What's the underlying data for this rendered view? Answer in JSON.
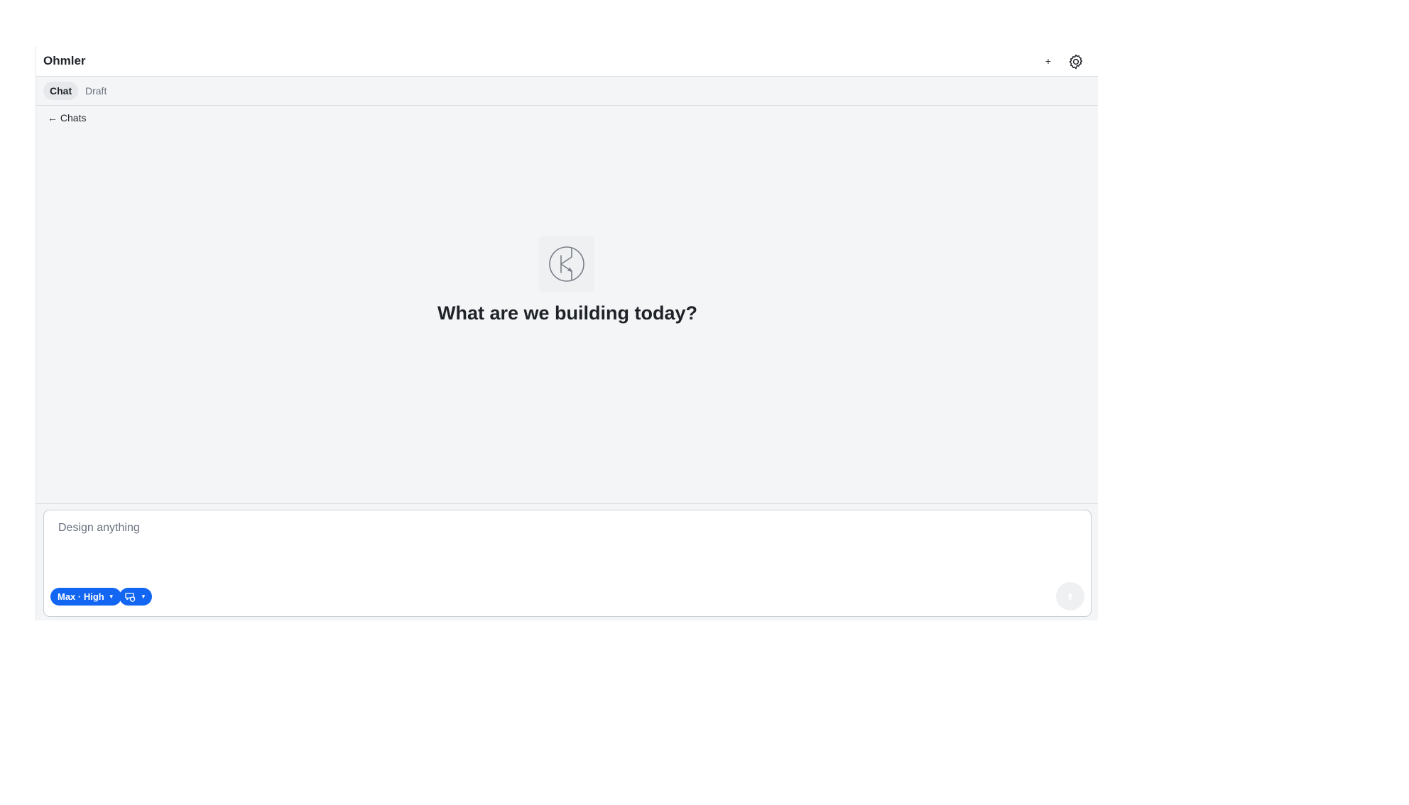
{
  "header": {
    "title": "Ohmler",
    "new_chat_icon": "plus-icon",
    "settings_icon": "gear-icon"
  },
  "tabs": [
    {
      "label": "Chat",
      "active": true
    },
    {
      "label": "Draft",
      "active": false
    }
  ],
  "back_link": {
    "label": "← Chats"
  },
  "empty_state": {
    "logo_icon": "transistor-logo-icon",
    "headline": "What are we building today?"
  },
  "composer": {
    "placeholder": "Design anything",
    "value": "",
    "model_selector": {
      "label": "Max · High",
      "icon": "chevron-down-icon"
    },
    "mode_selector": {
      "icon": "chat-shield-icon"
    },
    "send_icon": "arrow-up-icon"
  },
  "colors": {
    "accent": "#1266f1",
    "panel_background": "#f4f5f7",
    "text": "#1f2328"
  }
}
